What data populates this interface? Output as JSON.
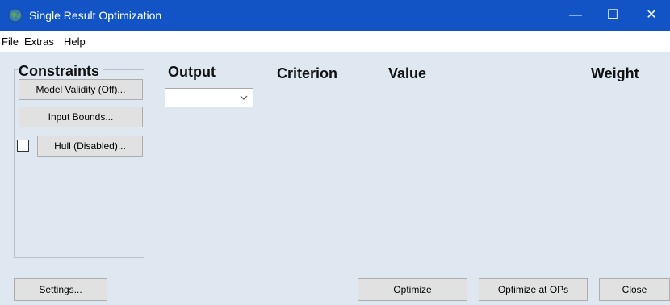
{
  "window": {
    "title": "Single Result Optimization",
    "app_icon": "globe-icon",
    "controls": {
      "minimize": "—",
      "maximize": "☐",
      "close": "✕"
    }
  },
  "menu": {
    "file": "File",
    "extras": "Extras",
    "help": "Help"
  },
  "constraints": {
    "title": "Constraints",
    "model_validity_label": "Model Validity (Off)...",
    "input_bounds_label": "Input Bounds...",
    "hull_label": "Hull (Disabled)...",
    "hull_checked": false
  },
  "columns": {
    "output": "Output",
    "criterion": "Criterion",
    "value": "Value",
    "weight": "Weight"
  },
  "output_select": {
    "selected": ""
  },
  "footer": {
    "settings_label": "Settings...",
    "optimize_label": "Optimize",
    "optimize_ops_label": "Optimize at OPs",
    "close_label": "Close"
  },
  "colors": {
    "titlebar": "#1253c5",
    "background": "#dfe7f1",
    "button": "#e1e1e1"
  }
}
